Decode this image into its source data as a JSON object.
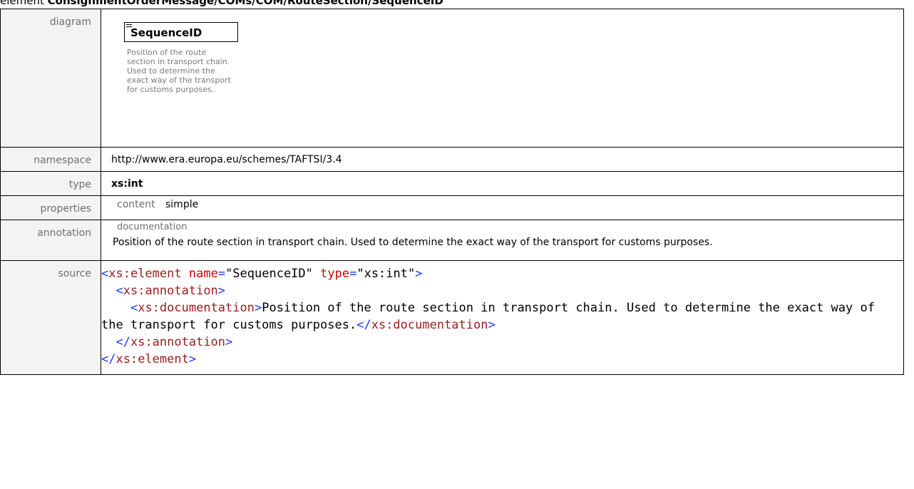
{
  "heading": {
    "prefix": "element ",
    "path": "ConsignmentOrderMessage/COMs/COM/RouteSection/SequenceID"
  },
  "rows": {
    "diagram": {
      "label": "diagram",
      "element_name": "SequenceID",
      "note": "Position of the route section in transport chain. Used to determine the exact way of the transport for customs purposes."
    },
    "namespace": {
      "label": "namespace",
      "value": "http://www.era.europa.eu/schemes/TAFTSI/3.4"
    },
    "type": {
      "label": "type",
      "value": "xs:int"
    },
    "properties": {
      "label": "properties",
      "key": "content",
      "value": "simple"
    },
    "annotation": {
      "label": "annotation",
      "key": "documentation",
      "text": "Position of the route section in transport chain. Used to determine the exact way of the transport for customs purposes."
    },
    "source": {
      "label": "source",
      "open_tag": "xs:element",
      "attr1_name": "name",
      "attr1_value": "\"SequenceID\"",
      "attr2_name": "type",
      "attr2_value": "\"xs:int\"",
      "annotation_tag": "xs:annotation",
      "documentation_tag": "xs:documentation",
      "documentation_text": "Position of the route section in transport chain. Used to determine the exact way of the transport for customs purposes."
    }
  },
  "colors": {
    "tag": "#9b1c1c",
    "attribute": "#d00000",
    "punctuation": "#1a3aff",
    "label": "#6f6f6f"
  }
}
